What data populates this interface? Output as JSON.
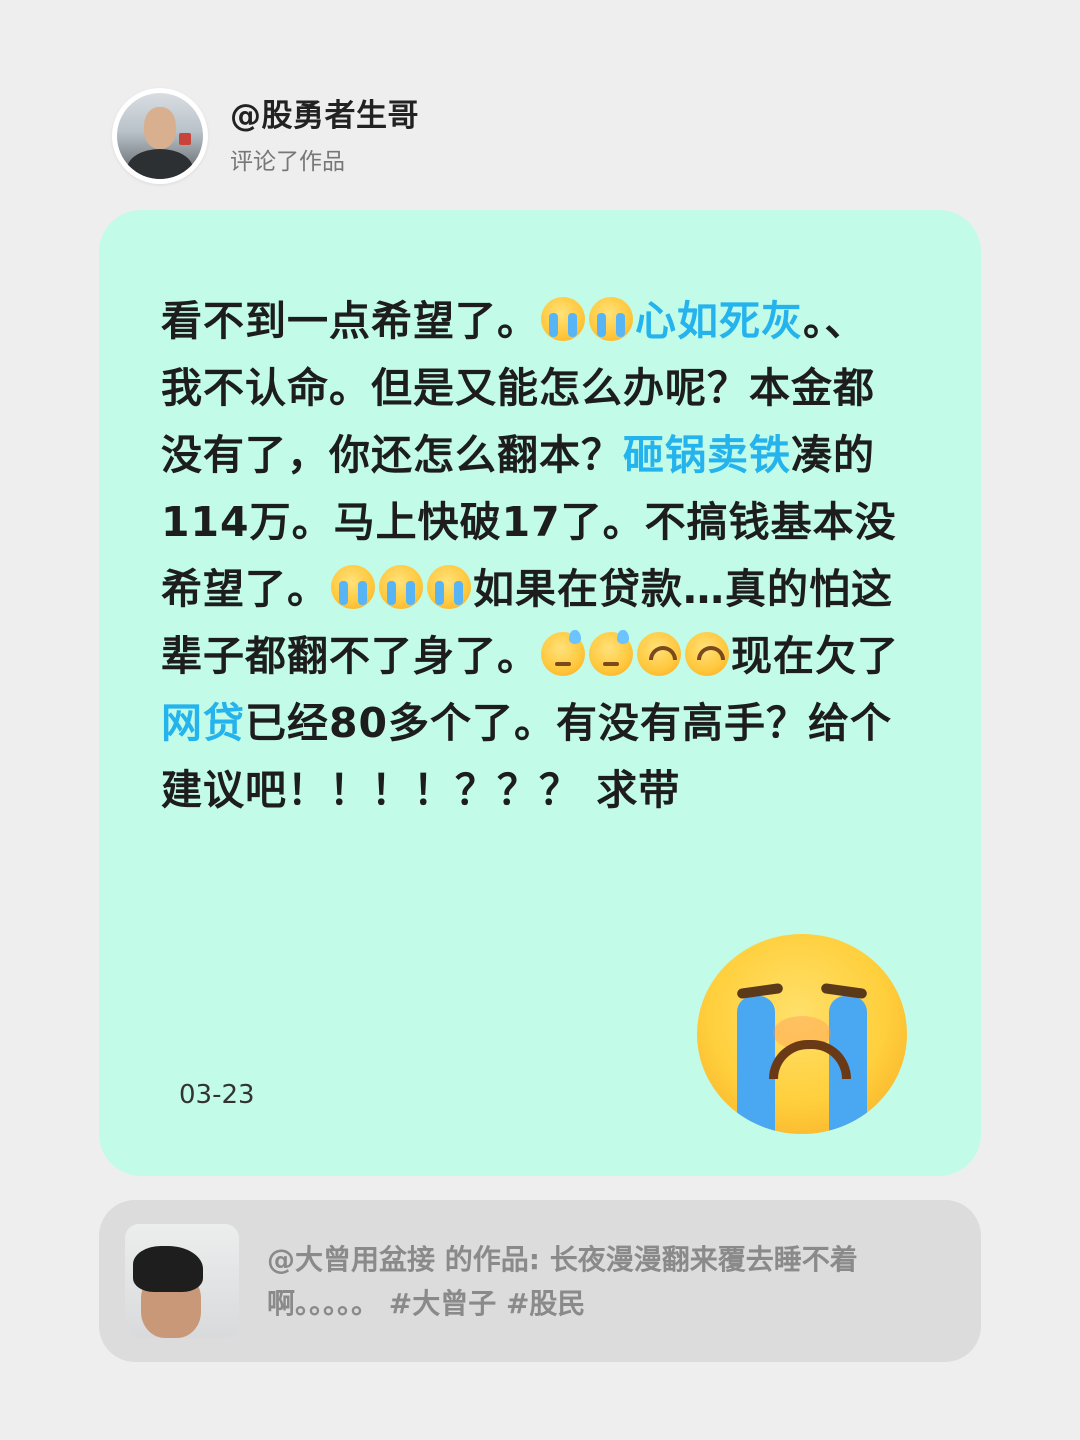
{
  "header": {
    "username": "@股勇者生哥",
    "action": "评论了作品"
  },
  "comment": {
    "segments": [
      {
        "type": "text",
        "value": "看不到一点希望了。"
      },
      {
        "type": "emoji",
        "icon": "loudly-crying-face-icon",
        "style": "cry"
      },
      {
        "type": "emoji",
        "icon": "loudly-crying-face-icon",
        "style": "cry"
      },
      {
        "type": "link",
        "value": "心如死灰"
      },
      {
        "type": "text",
        "value": "。、我不认命。但是又能怎么办呢？本金都没有了，你还怎么翻本？"
      },
      {
        "type": "link",
        "value": "砸锅卖铁"
      },
      {
        "type": "text",
        "value": "凑的114万。马上快破17了。不搞钱基本没希望了。"
      },
      {
        "type": "emoji",
        "icon": "loudly-crying-face-icon",
        "style": "cry"
      },
      {
        "type": "emoji",
        "icon": "loudly-crying-face-icon",
        "style": "cry"
      },
      {
        "type": "emoji",
        "icon": "loudly-crying-face-icon",
        "style": "cry"
      },
      {
        "type": "text",
        "value": "如果在贷款…真的怕这辈子都翻不了身了。"
      },
      {
        "type": "emoji",
        "icon": "downcast-sweat-face-icon",
        "style": "sweat"
      },
      {
        "type": "emoji",
        "icon": "downcast-sweat-face-icon",
        "style": "sweat"
      },
      {
        "type": "emoji",
        "icon": "upside-down-face-icon",
        "style": "ud"
      },
      {
        "type": "emoji",
        "icon": "upside-down-face-icon",
        "style": "ud"
      },
      {
        "type": "text",
        "value": "现在欠了"
      },
      {
        "type": "link",
        "value": "网贷"
      },
      {
        "type": "text",
        "value": "已经80多个了。有没有高手？给个建议吧！！！！？？？ 求带"
      }
    ],
    "date": "03-23",
    "sticker_icon": "big-loudly-crying-face-icon"
  },
  "reference": {
    "text": "@大曾用盆接 的作品: 长夜漫漫翻来覆去睡不着啊。。。。。 #大曾子 #股民"
  },
  "colors": {
    "background": "#eeeeee",
    "card": "#c2fbe8",
    "link": "#25b3ee",
    "ref_card": "#dcdcdc"
  }
}
